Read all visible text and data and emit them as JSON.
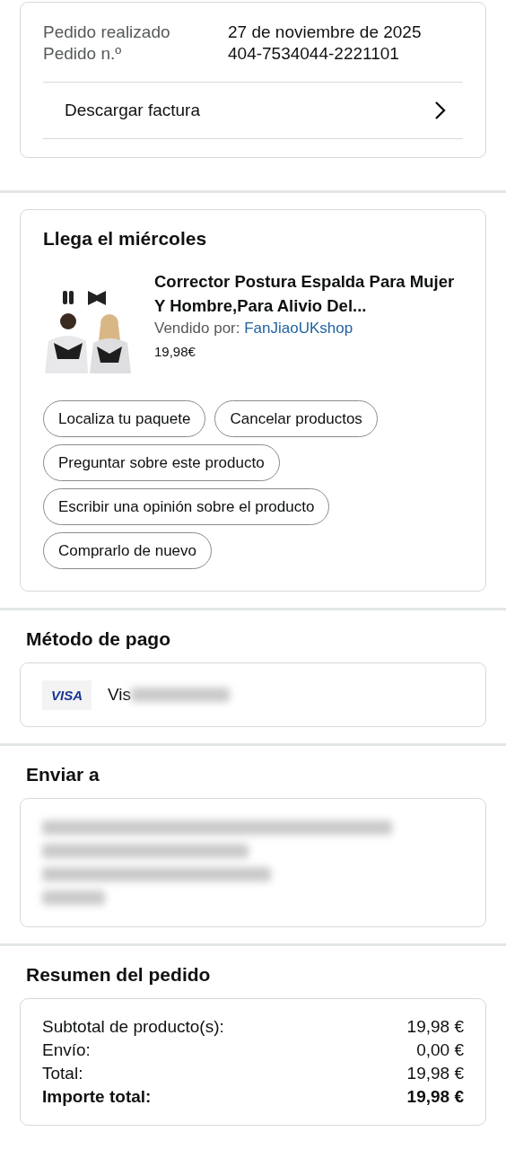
{
  "order_info": {
    "rows": [
      {
        "label": "Pedido realizado",
        "value": "27 de noviembre de 2025"
      },
      {
        "label": "Pedido n.º",
        "value": "404-7534044-2221101"
      }
    ],
    "invoice_link": "Descargar factura"
  },
  "delivery": {
    "title": "Llega el miércoles",
    "product": {
      "title": "Corrector Postura Espalda Para Mujer Y Hombre,Para Alivio Del...",
      "seller_label": "Vendido por:",
      "seller": "FanJiaoUKshop",
      "price": "19,98€"
    },
    "actions": [
      [
        "Localiza tu paquete",
        "Cancelar productos"
      ],
      [
        "Preguntar sobre este producto"
      ],
      [
        "Escribir una opinión sobre el producto"
      ],
      [
        "Comprarlo de nuevo"
      ]
    ]
  },
  "payment": {
    "title": "Método de pago",
    "card_brand": "VISA",
    "card_text": "Vis"
  },
  "shipping": {
    "title": "Enviar a"
  },
  "summary": {
    "title": "Resumen del pedido",
    "rows": [
      {
        "label": "Subtotal de producto(s):",
        "value": "19,98 €",
        "emphasis": false
      },
      {
        "label": "Envío:",
        "value": "0,00 €",
        "emphasis": false
      },
      {
        "label": "Total:",
        "value": "19,98 €",
        "emphasis": false
      },
      {
        "label": "Importe total:",
        "value": "19,98 €",
        "emphasis": true
      }
    ]
  }
}
